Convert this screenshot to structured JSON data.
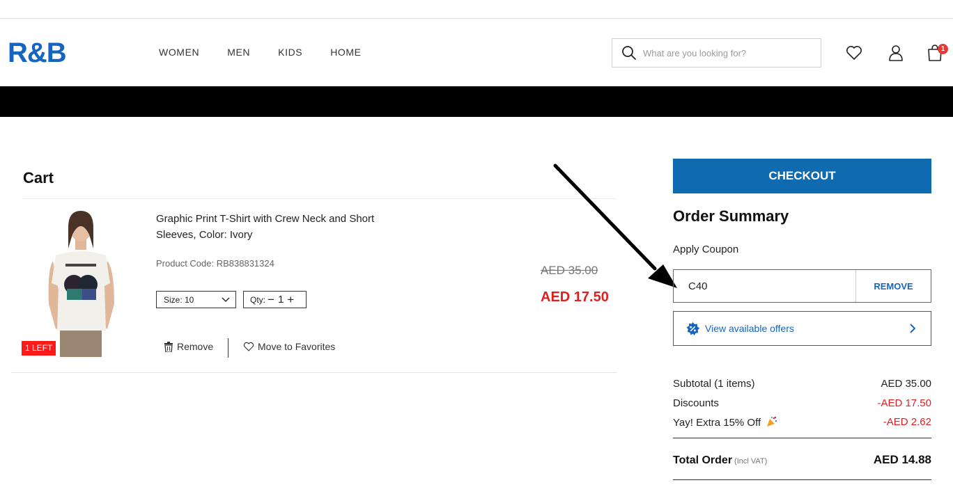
{
  "header": {
    "logo": "R&B",
    "nav": [
      "WOMEN",
      "MEN",
      "KIDS",
      "HOME"
    ],
    "search_placeholder": "What are you looking for?",
    "cart_count": "1"
  },
  "cart": {
    "title": "Cart",
    "item": {
      "name": "Graphic Print T-Shirt with Crew Neck and Short Sleeves, Color: Ivory",
      "code": "Product Code: RB838831324",
      "size": "Size: 10",
      "qty_label": "Qty:",
      "qty": "1",
      "price_old": "AED 35.00",
      "price_new": "AED 17.50",
      "stock_badge": "1 LEFT",
      "remove": "Remove",
      "favorite": "Move to Favorites"
    }
  },
  "summary": {
    "checkout": "CHECKOUT",
    "title": "Order Summary",
    "coupon_label": "Apply Coupon",
    "coupon_value": "C40",
    "coupon_action": "REMOVE",
    "offers": "View available offers",
    "subtotal_label": "Subtotal (1 items)",
    "subtotal_value": "AED 35.00",
    "discount_label": "Discounts",
    "discount_value": "-AED 17.50",
    "extra_label": "Yay! Extra 15% Off",
    "extra_value": "-AED 2.62",
    "total_label": "Total Order",
    "total_note": "(Incl VAT)",
    "total_value": "AED 14.88"
  },
  "colors": {
    "brand": "#1565c0",
    "checkout": "#106aaf",
    "sale": "#e02020"
  }
}
